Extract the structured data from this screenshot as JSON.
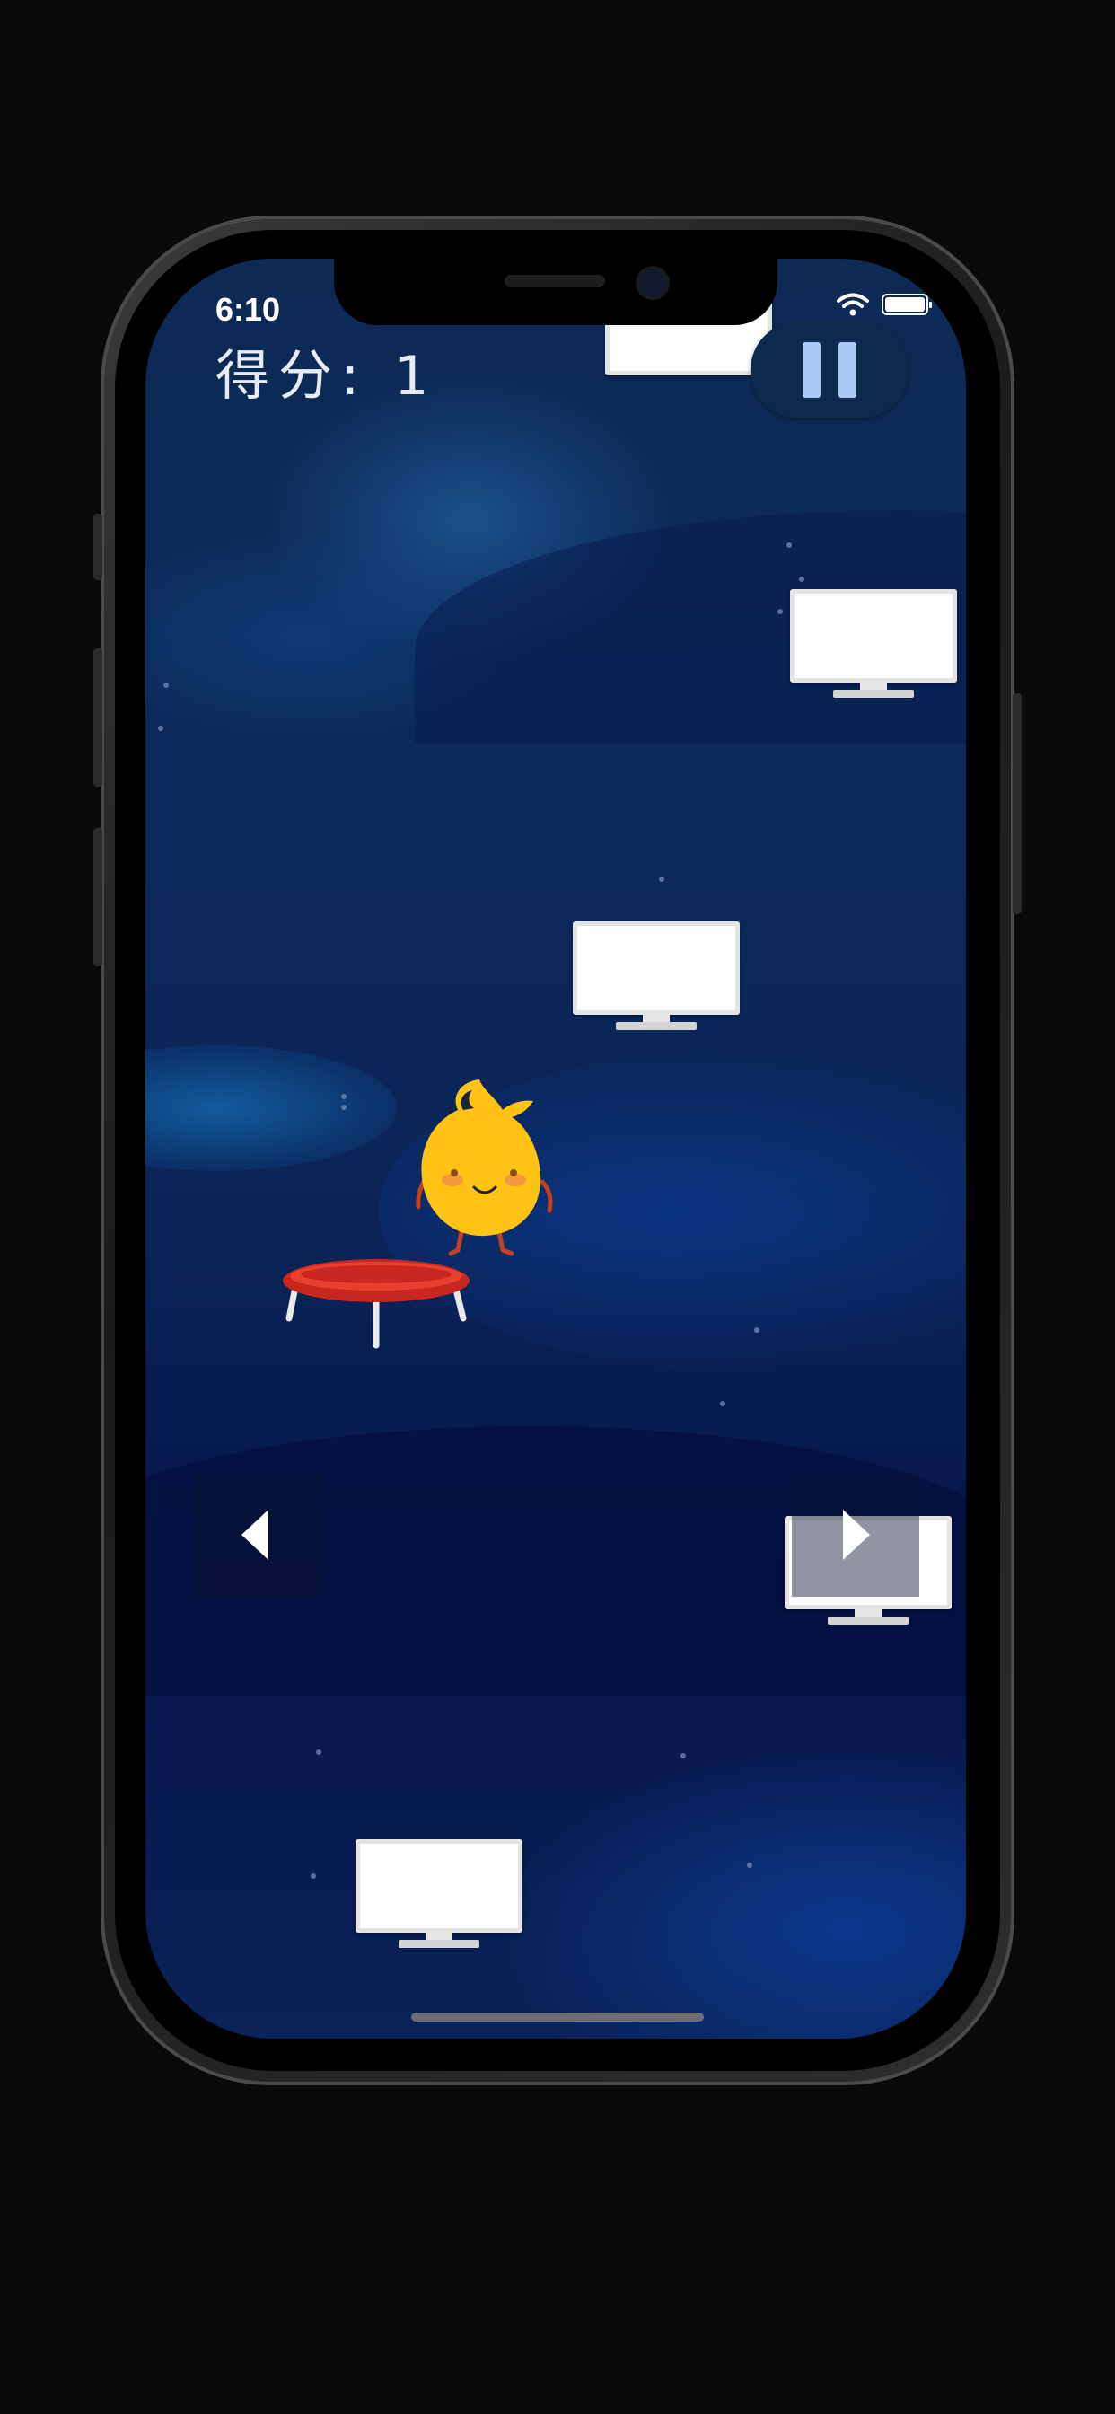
{
  "status_bar": {
    "time": "6:10",
    "icons": [
      "wifi-icon",
      "battery-icon"
    ]
  },
  "hud": {
    "score_label": "得分:",
    "score_value": "1",
    "pause_icon": "pause-icon"
  },
  "game": {
    "player": "flame-character",
    "objects": [
      "monitor-platform",
      "trampoline"
    ],
    "controls": {
      "left_icon": "left-arrow-icon",
      "right_icon": "right-arrow-icon"
    }
  },
  "colors": {
    "background": "#0a2456",
    "player": "#ffc316",
    "trampoline": "#e0362b",
    "pause_bar": "#a9c9f5"
  }
}
